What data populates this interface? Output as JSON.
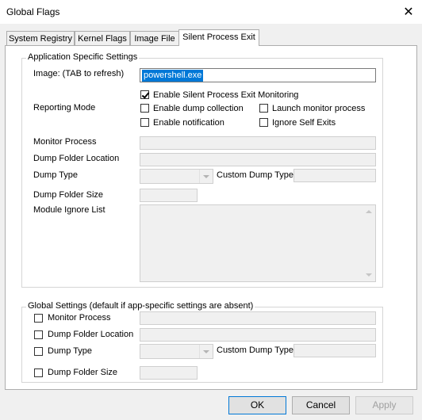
{
  "window": {
    "title": "Global Flags",
    "close_glyph": "✕"
  },
  "tabs": [
    {
      "label": "System Registry"
    },
    {
      "label": "Kernel Flags"
    },
    {
      "label": "Image File"
    },
    {
      "label": "Silent Process Exit"
    }
  ],
  "app_settings": {
    "group_label": "Application Specific Settings",
    "image_label": "Image:  (TAB to refresh)",
    "image_value": "powershell.exe",
    "reporting_mode_label": "Reporting Mode",
    "enable_monitoring_label": "Enable Silent Process Exit Monitoring",
    "enable_dump_label": "Enable dump collection",
    "launch_monitor_label": "Launch monitor process",
    "enable_notification_label": "Enable notification",
    "ignore_self_exits_label": "Ignore Self Exits",
    "monitor_process_label": "Monitor Process",
    "dump_folder_location_label": "Dump Folder Location",
    "dump_type_label": "Dump Type",
    "custom_dump_type_label": "Custom Dump Type",
    "dump_folder_size_label": "Dump Folder Size",
    "module_ignore_list_label": "Module Ignore List"
  },
  "global_settings": {
    "group_label": "Global Settings (default if app-specific settings are absent)",
    "monitor_process_label": "Monitor Process",
    "dump_folder_location_label": "Dump Folder Location",
    "dump_type_label": "Dump Type",
    "custom_dump_type_label": "Custom Dump Type",
    "dump_folder_size_label": "Dump Folder Size"
  },
  "buttons": {
    "ok": "OK",
    "cancel": "Cancel",
    "apply": "Apply"
  }
}
